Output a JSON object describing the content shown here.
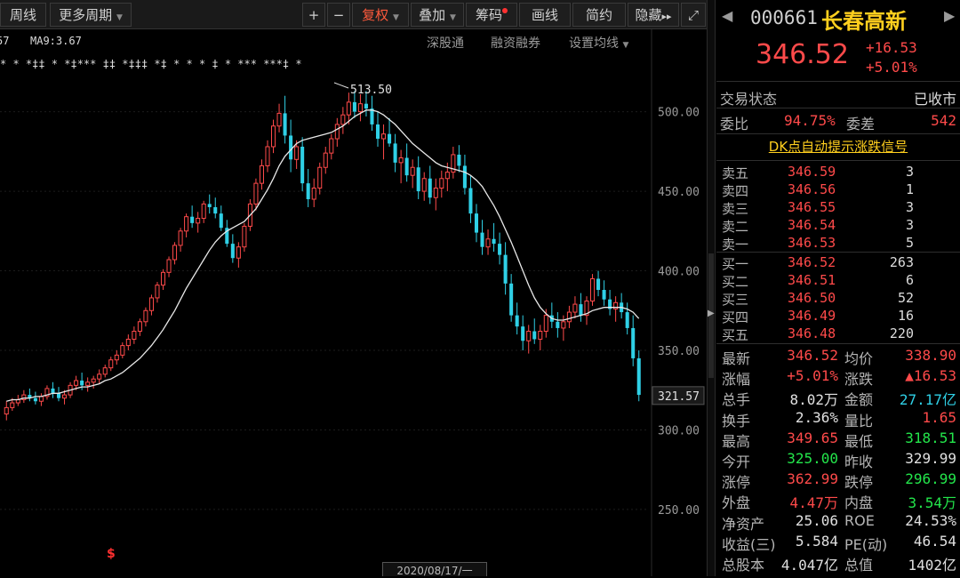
{
  "toolbar": {
    "weekly": "周线",
    "more_periods": "更多周期",
    "plus": "+",
    "minus": "−",
    "restore_rights": "复权",
    "overlay": "叠加",
    "chips": "筹码",
    "draw": "画线",
    "simple": "简约",
    "hide": "隐藏",
    "more_icon": "▸▸",
    "fullscreen_icon": "⤢"
  },
  "chart": {
    "ma_left_value": "57",
    "ma_label": "MA9:3.67",
    "links": [
      "深股通",
      "融资融券",
      "设置均线"
    ],
    "peak_label": "513.50",
    "last_price_label": "321.57",
    "marker_row": "*  *  *‡‡  *  *‡*** ‡‡  *‡‡‡  *‡  *  *    *   ‡   *    ***  ***‡  *",
    "dollar_marker": "$",
    "date_label": "2020/08/17/一"
  },
  "chart_data": {
    "type": "candlestick",
    "y_ticks": [
      500,
      450,
      400,
      350,
      300,
      250
    ],
    "ylim": [
      222,
      535
    ],
    "peak": 513.5,
    "last_close": 321.57,
    "candles": [
      [
        310,
        318,
        306,
        314
      ],
      [
        314,
        320,
        312,
        317
      ],
      [
        317,
        322,
        315,
        319
      ],
      [
        319,
        325,
        317,
        322
      ],
      [
        322,
        326,
        318,
        320
      ],
      [
        320,
        324,
        316,
        318
      ],
      [
        318,
        323,
        315,
        321
      ],
      [
        321,
        328,
        319,
        326
      ],
      [
        326,
        330,
        320,
        323
      ],
      [
        323,
        327,
        318,
        320
      ],
      [
        320,
        325,
        316,
        322
      ],
      [
        322,
        330,
        320,
        328
      ],
      [
        328,
        334,
        325,
        331
      ],
      [
        331,
        336,
        325,
        328
      ],
      [
        328,
        333,
        324,
        330
      ],
      [
        330,
        334,
        326,
        332
      ],
      [
        332,
        338,
        329,
        335
      ],
      [
        335,
        341,
        333,
        339
      ],
      [
        339,
        346,
        337,
        344
      ],
      [
        344,
        350,
        341,
        347
      ],
      [
        347,
        355,
        345,
        353
      ],
      [
        353,
        360,
        350,
        357
      ],
      [
        357,
        365,
        354,
        362
      ],
      [
        362,
        370,
        359,
        368
      ],
      [
        368,
        377,
        365,
        375
      ],
      [
        375,
        385,
        372,
        383
      ],
      [
        383,
        393,
        380,
        391
      ],
      [
        391,
        401,
        388,
        399
      ],
      [
        399,
        409,
        396,
        407
      ],
      [
        407,
        418,
        404,
        416
      ],
      [
        416,
        427,
        412,
        425
      ],
      [
        425,
        436,
        421,
        434
      ],
      [
        434,
        441,
        427,
        430
      ],
      [
        430,
        437,
        424,
        433
      ],
      [
        433,
        444,
        430,
        442
      ],
      [
        442,
        448,
        436,
        440
      ],
      [
        440,
        446,
        433,
        436
      ],
      [
        436,
        441,
        425,
        427
      ],
      [
        427,
        432,
        415,
        417
      ],
      [
        417,
        423,
        405,
        408
      ],
      [
        408,
        418,
        402,
        415
      ],
      [
        415,
        430,
        412,
        428
      ],
      [
        428,
        445,
        425,
        442
      ],
      [
        442,
        458,
        438,
        455
      ],
      [
        455,
        470,
        451,
        466
      ],
      [
        466,
        482,
        462,
        478
      ],
      [
        478,
        495,
        474,
        491
      ],
      [
        491,
        505,
        487,
        499
      ],
      [
        499,
        510,
        480,
        485
      ],
      [
        485,
        495,
        462,
        470
      ],
      [
        470,
        482,
        464,
        478
      ],
      [
        478,
        484,
        450,
        455
      ],
      [
        455,
        464,
        440,
        445
      ],
      [
        445,
        458,
        440,
        452
      ],
      [
        452,
        468,
        448,
        465
      ],
      [
        465,
        478,
        461,
        474
      ],
      [
        474,
        486,
        470,
        483
      ],
      [
        483,
        496,
        478,
        492
      ],
      [
        492,
        503,
        486,
        498
      ],
      [
        498,
        512,
        492,
        506
      ],
      [
        506,
        513,
        496,
        500
      ],
      [
        500,
        511,
        494,
        505
      ],
      [
        505,
        513,
        497,
        502
      ],
      [
        502,
        510,
        488,
        492
      ],
      [
        492,
        500,
        478,
        483
      ],
      [
        483,
        492,
        470,
        486
      ],
      [
        486,
        496,
        478,
        480
      ],
      [
        480,
        486,
        462,
        468
      ],
      [
        468,
        476,
        455,
        471
      ],
      [
        471,
        480,
        456,
        460
      ],
      [
        460,
        470,
        452,
        465
      ],
      [
        465,
        472,
        445,
        450
      ],
      [
        450,
        462,
        444,
        458
      ],
      [
        458,
        466,
        442,
        446
      ],
      [
        446,
        458,
        438,
        452
      ],
      [
        452,
        463,
        446,
        458
      ],
      [
        458,
        468,
        450,
        462
      ],
      [
        462,
        478,
        458,
        473
      ],
      [
        473,
        479,
        462,
        466
      ],
      [
        466,
        473,
        448,
        452
      ],
      [
        452,
        460,
        430,
        436
      ],
      [
        436,
        442,
        418,
        424
      ],
      [
        424,
        432,
        410,
        415
      ],
      [
        415,
        426,
        410,
        420
      ],
      [
        420,
        430,
        412,
        417
      ],
      [
        417,
        424,
        404,
        410
      ],
      [
        410,
        418,
        385,
        392
      ],
      [
        392,
        398,
        368,
        372
      ],
      [
        372,
        380,
        360,
        365
      ],
      [
        365,
        372,
        350,
        356
      ],
      [
        356,
        366,
        348,
        362
      ],
      [
        362,
        370,
        354,
        357
      ],
      [
        357,
        366,
        350,
        362
      ],
      [
        362,
        376,
        358,
        372
      ],
      [
        372,
        380,
        364,
        368
      ],
      [
        368,
        374,
        358,
        364
      ],
      [
        364,
        372,
        356,
        368
      ],
      [
        368,
        378,
        364,
        374
      ],
      [
        374,
        384,
        370,
        379
      ],
      [
        379,
        386,
        368,
        372
      ],
      [
        372,
        384,
        366,
        381
      ],
      [
        381,
        398,
        378,
        395
      ],
      [
        395,
        400,
        384,
        388
      ],
      [
        388,
        394,
        378,
        382
      ],
      [
        382,
        388,
        372,
        376
      ],
      [
        376,
        384,
        368,
        380
      ],
      [
        380,
        386,
        370,
        374
      ],
      [
        374,
        380,
        360,
        364
      ],
      [
        364,
        372,
        340,
        345
      ],
      [
        345,
        350,
        318,
        322
      ]
    ],
    "ma": [
      318,
      319,
      319,
      320,
      320,
      321,
      321,
      322,
      323,
      323,
      324,
      325,
      326,
      327,
      327,
      328,
      329,
      331,
      332,
      334,
      336,
      339,
      342,
      345,
      349,
      353,
      358,
      363,
      369,
      375,
      382,
      389,
      395,
      401,
      407,
      413,
      418,
      422,
      425,
      427,
      429,
      431,
      435,
      439,
      445,
      451,
      458,
      466,
      472,
      476,
      480,
      482,
      483,
      484,
      485,
      486,
      487,
      489,
      491,
      494,
      497,
      499,
      501,
      501,
      500,
      498,
      495,
      492,
      488,
      484,
      480,
      477,
      474,
      471,
      468,
      466,
      465,
      464,
      463,
      462,
      460,
      457,
      453,
      447,
      441,
      434,
      426,
      418,
      409,
      400,
      391,
      383,
      377,
      373,
      370,
      369,
      369,
      370,
      371,
      372,
      373,
      375,
      376,
      377,
      377,
      377,
      377,
      376,
      374,
      370
    ]
  },
  "quote": {
    "prev_arrow": "◀",
    "next_arrow": "▶",
    "code": "000661",
    "name": "长春高新",
    "price": "346.52",
    "change": "+16.53",
    "change_pct": "+5.01%",
    "trade_status_label": "交易状态",
    "trade_status": "已收市",
    "wb_label": "委比",
    "wb_value": "94.75%",
    "wc_label": "委差",
    "wc_value": "542",
    "dk_link": "DK点自动提示涨跌信号"
  },
  "orderbook": {
    "asks": [
      {
        "label": "卖五",
        "price": "346.59",
        "vol": "3"
      },
      {
        "label": "卖四",
        "price": "346.56",
        "vol": "1"
      },
      {
        "label": "卖三",
        "price": "346.55",
        "vol": "3"
      },
      {
        "label": "卖二",
        "price": "346.54",
        "vol": "3"
      },
      {
        "label": "卖一",
        "price": "346.53",
        "vol": "5"
      }
    ],
    "bids": [
      {
        "label": "买一",
        "price": "346.52",
        "vol": "263"
      },
      {
        "label": "买二",
        "price": "346.51",
        "vol": "6"
      },
      {
        "label": "买三",
        "price": "346.50",
        "vol": "52"
      },
      {
        "label": "买四",
        "price": "346.49",
        "vol": "16"
      },
      {
        "label": "买五",
        "price": "346.48",
        "vol": "220"
      }
    ]
  },
  "stats": [
    {
      "l1": "最新",
      "v1": "346.52",
      "c1": "red",
      "l2": "均价",
      "v2": "338.90",
      "c2": "red"
    },
    {
      "l1": "涨幅",
      "v1": "+5.01%",
      "c1": "red",
      "l2": "涨跌",
      "v2": "▲16.53",
      "c2": "red"
    },
    {
      "l1": "总手",
      "v1": "8.02万",
      "c1": "white",
      "l2": "金额",
      "v2": "27.17亿",
      "c2": "cyan"
    },
    {
      "l1": "换手",
      "v1": "2.36%",
      "c1": "white",
      "l2": "量比",
      "v2": "1.65",
      "c2": "red"
    },
    {
      "l1": "最高",
      "v1": "349.65",
      "c1": "red",
      "l2": "最低",
      "v2": "318.51",
      "c2": "green"
    },
    {
      "l1": "今开",
      "v1": "325.00",
      "c1": "green",
      "l2": "昨收",
      "v2": "329.99",
      "c2": "white"
    },
    {
      "l1": "涨停",
      "v1": "362.99",
      "c1": "red",
      "l2": "跌停",
      "v2": "296.99",
      "c2": "green"
    },
    {
      "l1": "外盘",
      "v1": "4.47万",
      "c1": "red",
      "l2": "内盘",
      "v2": "3.54万",
      "c2": "green"
    },
    {
      "l1": "净资产",
      "v1": "25.06",
      "c1": "white",
      "l2": "ROE",
      "v2": "24.53%",
      "c2": "white"
    },
    {
      "l1": "收益(三)",
      "v1": "5.584",
      "c1": "white",
      "l2": "PE(动)",
      "v2": "46.54",
      "c2": "white"
    },
    {
      "l1": "总股本",
      "v1": "4.047亿",
      "c1": "white",
      "l2": "总值",
      "v2": "1402亿",
      "c2": "white"
    }
  ],
  "colors": {
    "up": "#ff4a4a",
    "down": "#2fd0e6",
    "ma": "#e8e8e8",
    "accent": "#ffcf1e"
  }
}
